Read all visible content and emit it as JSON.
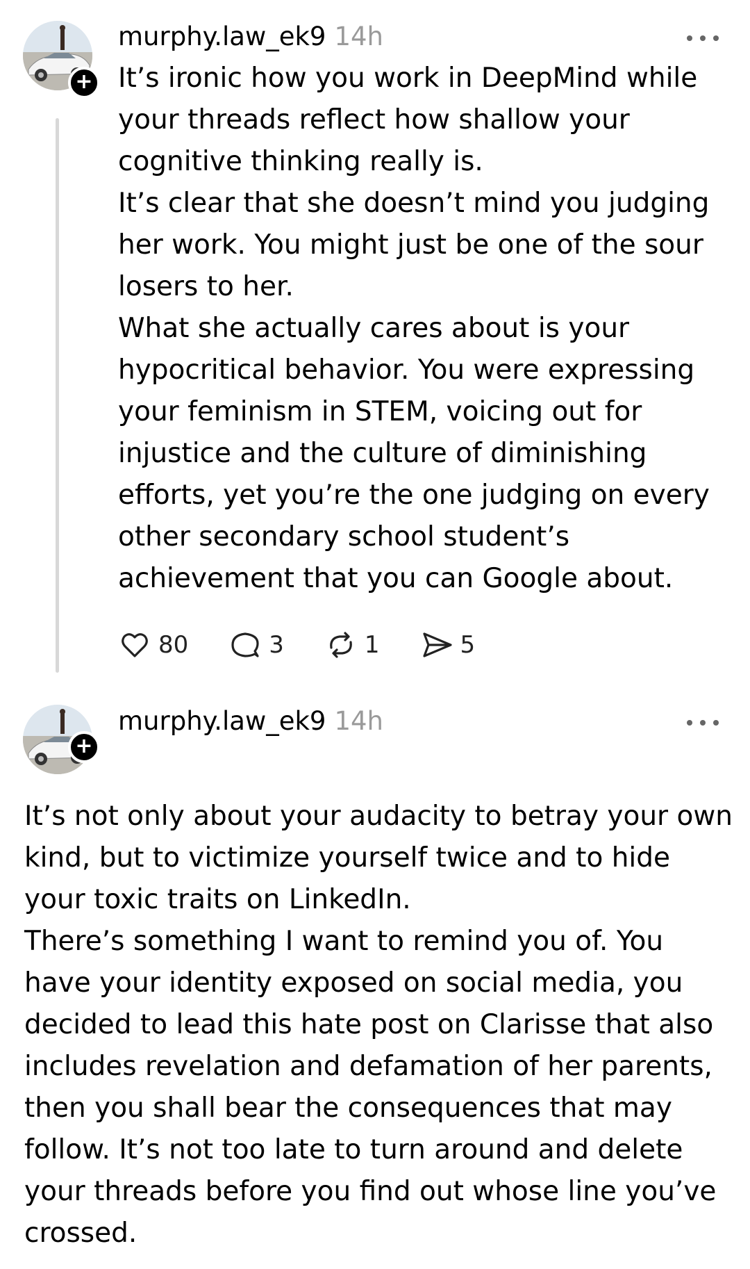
{
  "posts": [
    {
      "username": "murphy.law_ek9",
      "time": "14h",
      "paragraphs": [
        "It’s ironic how you work in DeepMind while your threads reflect how shallow your cognitive thinking really is.",
        "It’s clear that she doesn’t mind you judging her work. You might just be one of the sour losers to her.",
        "What she actually cares about is your hypocritical behavior. You were expressing your feminism in STEM, voicing out for injustice and the culture of diminishing efforts, yet you’re the one judging on every other secondary school student’s achievement that you can Google about."
      ],
      "counts": {
        "likes": "80",
        "replies": "3",
        "reposts": "1",
        "shares": "5"
      }
    },
    {
      "username": "murphy.law_ek9",
      "time": "14h",
      "paragraphs": [
        "It’s not only about your audacity to betray your own kind, but to victimize yourself twice and to hide your toxic traits on LinkedIn.",
        "There’s something I want to remind you of. You have your identity exposed on social media, you decided to lead this hate post on Clarisse that also includes revelation and defamation of her parents, then you shall bear the consequences that may follow. It’s not too late to turn around and delete your threads before you find out whose line you’ve crossed."
      ]
    }
  ],
  "icons": {
    "follow": "plus-icon",
    "more": "more-horizontal-icon",
    "like": "heart-icon",
    "reply": "comment-icon",
    "repost": "repost-icon",
    "share": "send-icon"
  }
}
